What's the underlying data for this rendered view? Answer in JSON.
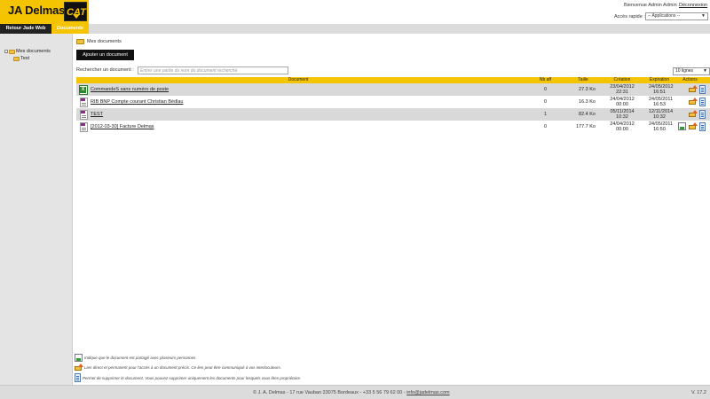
{
  "header": {
    "logo_text": "JA Delmas",
    "cat_text": "CAT",
    "welcome": "Bienvenue Admin Admin",
    "logout": "Déconnexion",
    "quick_access_label": "Accès rapide :",
    "quick_access_value": "-- Applications --"
  },
  "nav": {
    "retour": "Retour Jade Web",
    "documents": "Documents"
  },
  "sidebar": {
    "items": [
      {
        "label": "Mes documents"
      },
      {
        "label": "Test"
      }
    ]
  },
  "breadcrumb": "Mes documents",
  "add_button": "Ajouter un document",
  "search": {
    "label": "Rechercher un document :",
    "placeholder": "Entrer une partie du nom du document recherché"
  },
  "lines_select": "10 lignes",
  "table": {
    "headers": {
      "document": "Document",
      "nb_aff": "Nb aff",
      "taille": "Taille",
      "creation": "Création",
      "expiration": "Expiration",
      "actions": "Actions"
    },
    "rows": [
      {
        "icon": "excel-file-icon",
        "name": "CommandeS sans numéro de poste",
        "nb": "0",
        "size": "27.3 Ko",
        "created_date": "23/04/2012",
        "created_time": "22:31",
        "expires_date": "24/05/2012",
        "expires_time": "16:51"
      },
      {
        "icon": "file-icon",
        "name": "RIB BNP Compte courant Christian Bédlau",
        "nb": "0",
        "size": "16.3 Ko",
        "created_date": "24/04/2012",
        "created_time": "00:00",
        "expires_date": "24/05/2011",
        "expires_time": "16:53"
      },
      {
        "icon": "file-icon",
        "name": "TEST",
        "nb": "1",
        "size": "82.4 Ko",
        "created_date": "05/11/2014",
        "created_time": "10:32",
        "expires_date": "12/11/2014",
        "expires_time": "10:32"
      },
      {
        "icon": "file-icon",
        "name": "[2012-03-30] Facture Delmas",
        "nb": "0",
        "size": "177.7 Ko",
        "created_date": "24/04/2012",
        "created_time": "00:00",
        "expires_date": "24/05/2011",
        "expires_time": "16:50"
      }
    ]
  },
  "legend": [
    {
      "icon": "shared-icon",
      "text": "Indique que le document est partagé avec plusieurs personnes"
    },
    {
      "icon": "link-icon",
      "text": "Lien direct et permanent pour l'accès à un document précis. Ce lien peut être communiqué à vos interlocuteurs."
    },
    {
      "icon": "delete-icon",
      "text": "Permet de supprimer le document. Vous pouvez supprimer uniquement les documents pour lesquels vous êtes propriétaire."
    }
  ],
  "footer": {
    "text": "© J. A. Delmas - 17 rue Vauban 33075 Bordeaux - +33 5 56 79 62 00 -",
    "email": "info@jadelmas.com",
    "version": "V. 17.2"
  },
  "colors": {
    "brand_yellow": "#f5c400",
    "dark": "#111111",
    "row_alt": "#d9d9d9"
  }
}
